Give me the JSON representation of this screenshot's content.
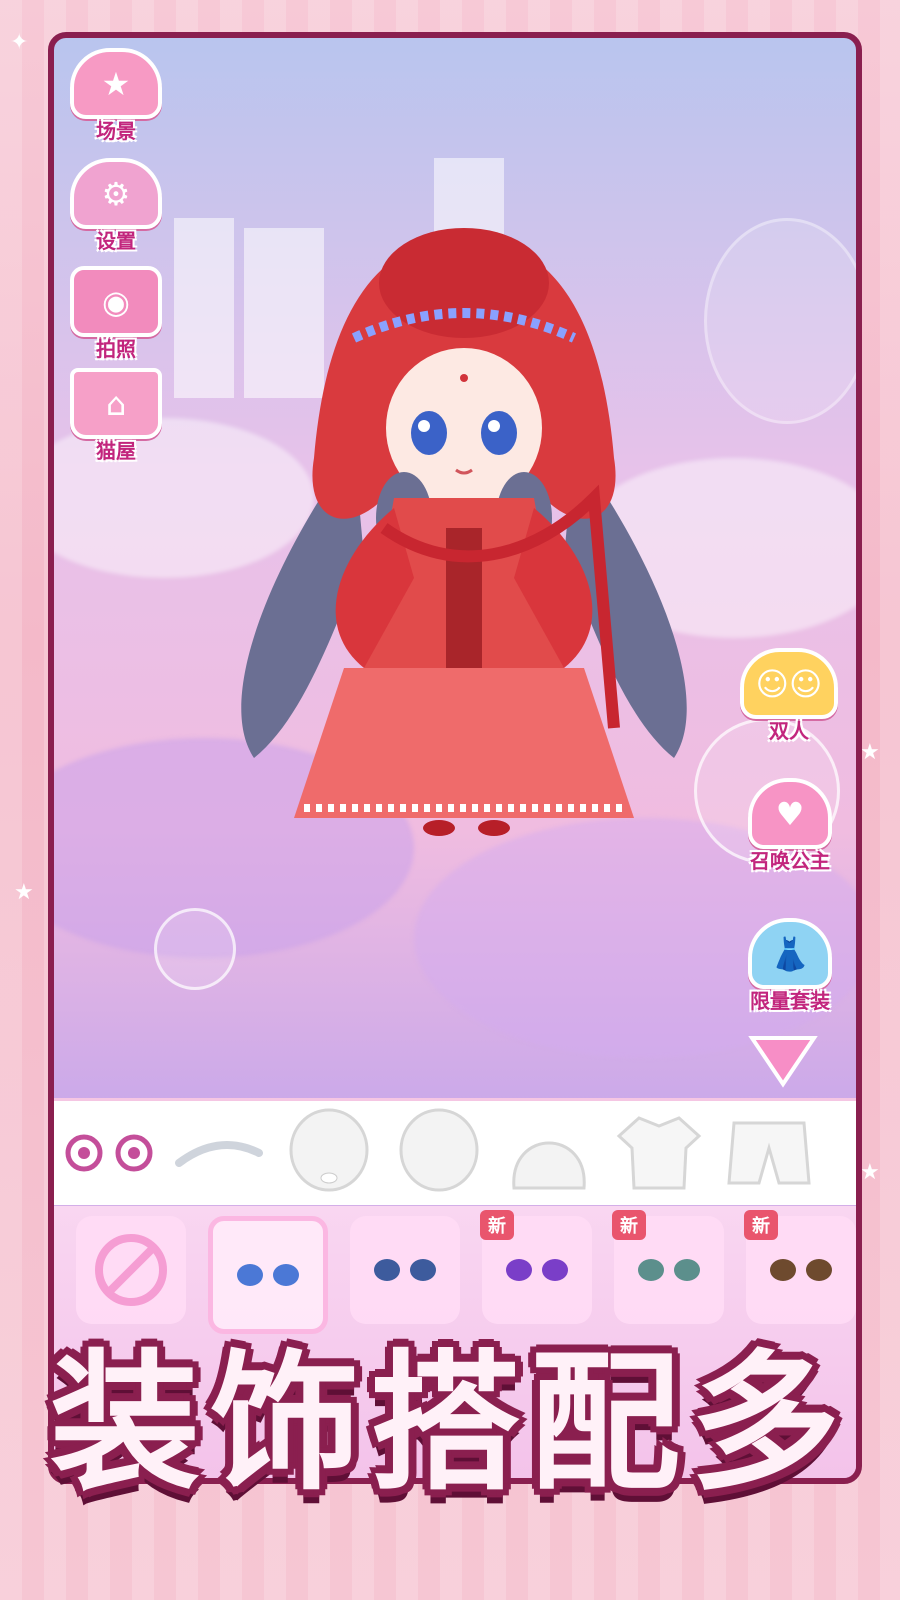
{
  "side_menu_left": [
    {
      "label": "场景",
      "icon": "star-scene-icon"
    },
    {
      "label": "设置",
      "icon": "gear-icon"
    },
    {
      "label": "拍照",
      "icon": "camera-icon"
    },
    {
      "label": "猫屋",
      "icon": "cat-house-icon"
    }
  ],
  "side_menu_right": [
    {
      "label": "双人",
      "icon": "two-girls-icon"
    },
    {
      "label": "召唤公主",
      "icon": "heart-summon-icon"
    },
    {
      "label": "限量套装",
      "icon": "dress-icon"
    }
  ],
  "collapse_icon": "down-triangle-icon",
  "part_tabs": [
    "eyes-icon",
    "eyebrow-icon",
    "face-icon",
    "face-alt-icon",
    "hair-icon",
    "shirt-icon",
    "pants-icon"
  ],
  "options": [
    {
      "type": "none",
      "new": false
    },
    {
      "type": "eyes",
      "new": false,
      "selected": true
    },
    {
      "type": "eyes",
      "new": false
    },
    {
      "type": "eyes",
      "new": true,
      "badge": "新"
    },
    {
      "type": "eyes",
      "new": true,
      "badge": "新"
    },
    {
      "type": "eyes",
      "new": true,
      "badge": "新"
    }
  ],
  "banner_text": "装饰搭配多",
  "colors": {
    "frame": "#8a1f4f",
    "label_pink": "#c2257d",
    "dress_red": "#e14b4b",
    "badge_red": "#e9556d"
  }
}
